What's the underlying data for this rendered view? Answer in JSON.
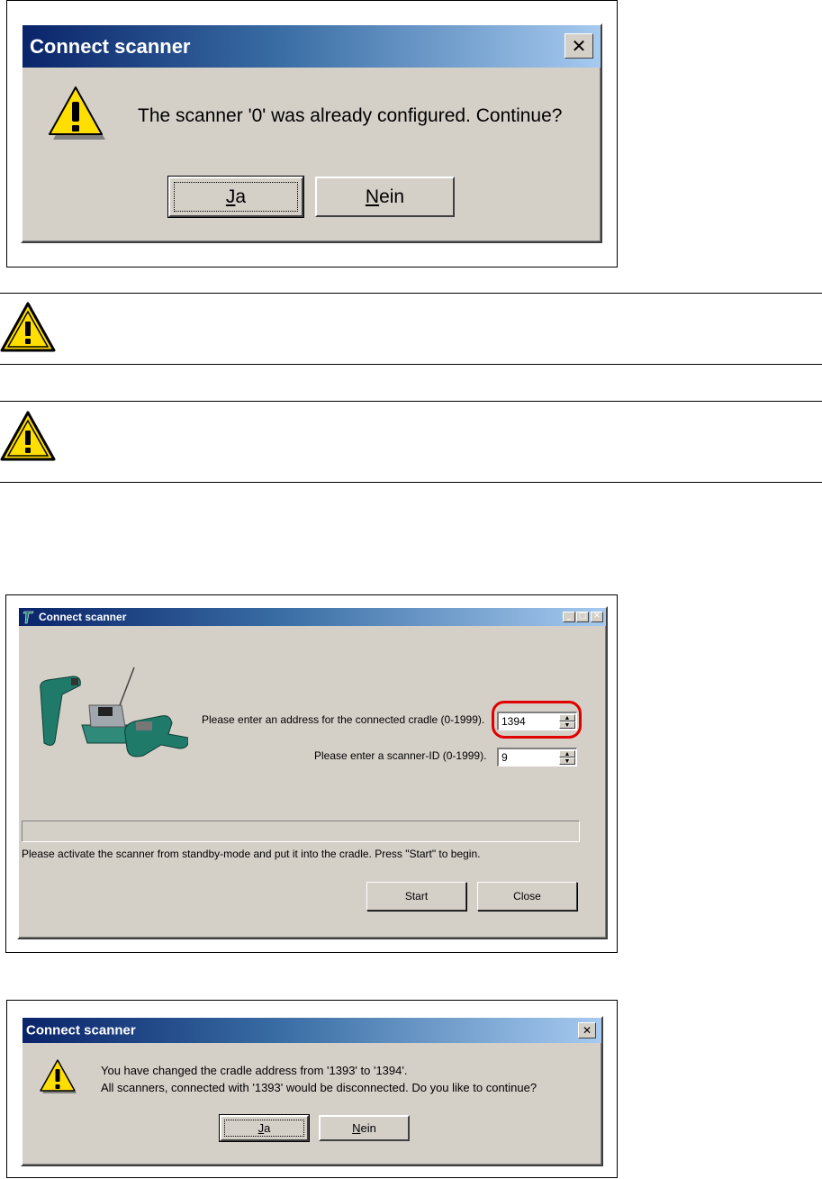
{
  "dialog1": {
    "title": "Connect scanner",
    "message": "The scanner '0' was already configured. Continue?",
    "btn_yes_ul": "J",
    "btn_yes_rest": "a",
    "btn_no_ul": "N",
    "btn_no_rest": "ein"
  },
  "screen2": {
    "title": "Connect scanner",
    "cradle_prompt": "Please enter an address for the connected cradle  (0-1999).",
    "cradle_value": "1394",
    "scanner_prompt": "Please enter a  scanner-ID (0-1999).",
    "scanner_value": "9",
    "progress": 0,
    "status": "Please activate the scanner from standby-mode and put it into the cradle. Press \"Start\" to begin.",
    "start_label": "Start",
    "close_label": "Close"
  },
  "dialog3": {
    "title": "Connect scanner",
    "message_line1": "You have changed the cradle address from '1393' to '1394'.",
    "message_line2": "All scanners, connected with '1393' would be disconnected. Do you like to continue?",
    "btn_yes_ul": "J",
    "btn_yes_rest": "a",
    "btn_no_ul": "N",
    "btn_no_rest": "ein"
  },
  "colors": {
    "dialog_face": "#d4d0c8",
    "title_gradient_start": "#0a246a",
    "title_gradient_end": "#a6caf0",
    "warning_yellow": "#ffde00",
    "highlight_ring": "#e00000"
  }
}
